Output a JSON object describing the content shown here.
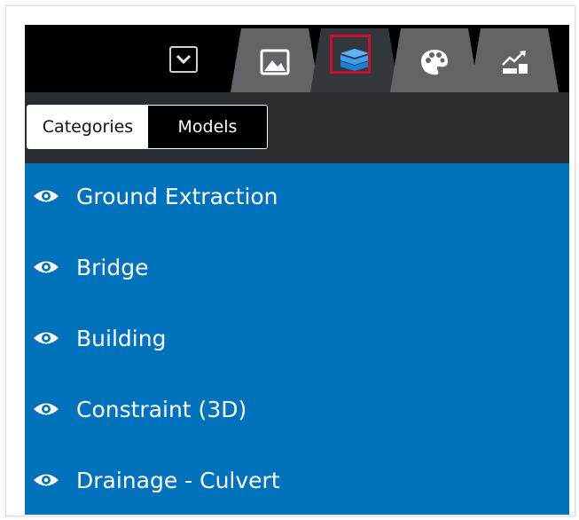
{
  "colors": {
    "topbar": "#000000",
    "tab_bg": "#636467",
    "tab_active_bg": "#34383c",
    "active_outline": "#c8102e",
    "list_bg": "#0071bb",
    "layers_icon": "#3aa0ff"
  },
  "header": {
    "dropdown_icon": "chevron-down-icon",
    "tabs": [
      {
        "icon": "landscape-image-icon"
      },
      {
        "icon": "layers-icon",
        "active": true
      },
      {
        "icon": "palette-icon"
      },
      {
        "icon": "financial-chart-icon"
      }
    ]
  },
  "toggle": {
    "categories_label": "Categories",
    "models_label": "Models",
    "selected": "Categories"
  },
  "categories": [
    {
      "label": "Ground Extraction",
      "icon": "eye-icon"
    },
    {
      "label": "Bridge",
      "icon": "eye-icon"
    },
    {
      "label": "Building",
      "icon": "eye-icon"
    },
    {
      "label": "Constraint (3D)",
      "icon": "eye-icon"
    },
    {
      "label": "Drainage - Culvert",
      "icon": "eye-icon"
    }
  ]
}
